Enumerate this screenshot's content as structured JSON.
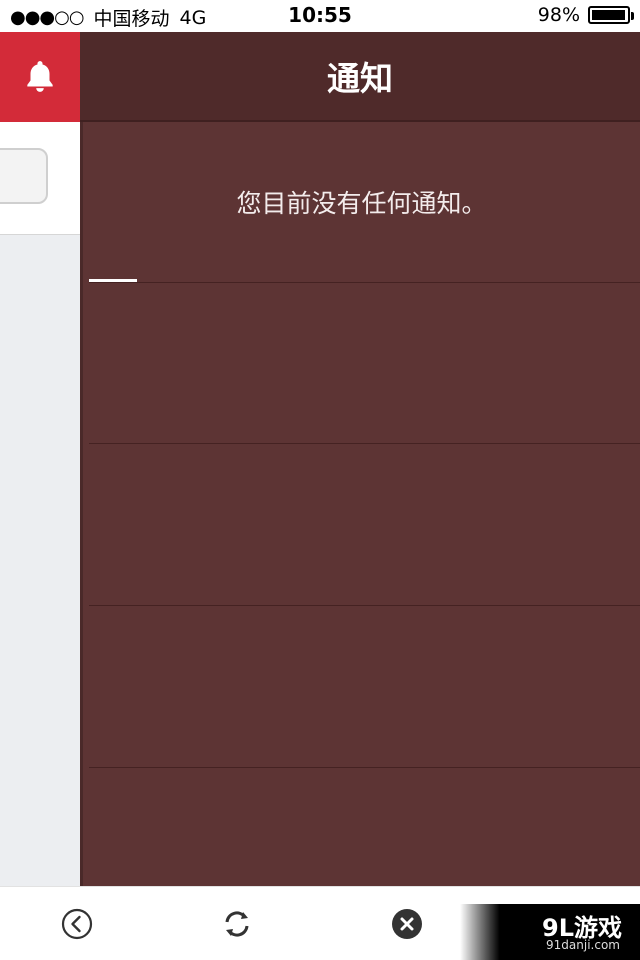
{
  "status_bar": {
    "signal": "●●●○○",
    "carrier": "中国移动",
    "network": "4G",
    "time": "10:55",
    "battery_percent": "98%",
    "battery_level": 0.98
  },
  "drawer": {
    "bell_icon": "bell-icon",
    "accent_color": "#d32b39"
  },
  "header": {
    "title": "通知"
  },
  "notifications": {
    "empty_message": "您目前没有任何通知。"
  },
  "toolbar": {
    "back_icon": "chevron-left-circle-icon",
    "refresh_icon": "refresh-icon",
    "close_icon": "close-circle-icon"
  },
  "watermark": {
    "logo": "9L游戏",
    "url": "91danji.com"
  },
  "colors": {
    "header_bg": "#4f2a2a",
    "body_bg": "#5d3434"
  }
}
